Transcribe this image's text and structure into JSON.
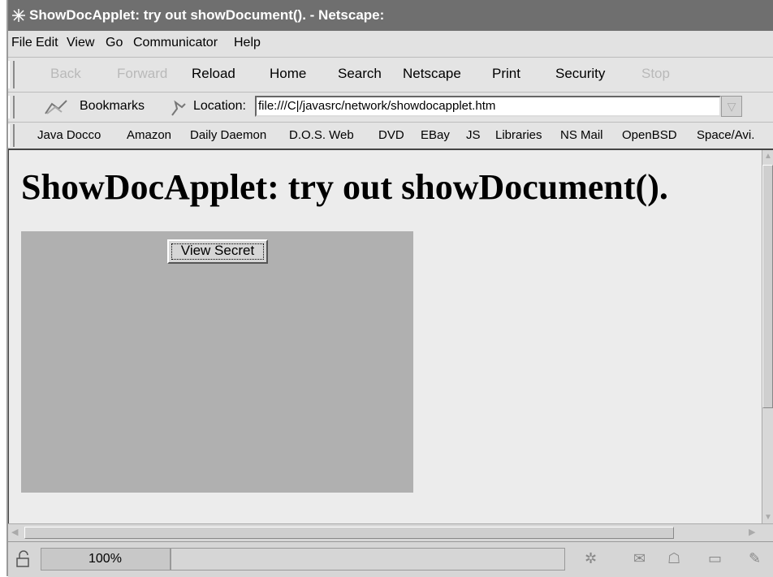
{
  "window": {
    "title": "ShowDocApplet: try out showDocument(). - Netscape:"
  },
  "menubar": {
    "items": [
      {
        "label": "File"
      },
      {
        "label": "Edit"
      },
      {
        "label": "View"
      },
      {
        "label": "Go"
      },
      {
        "label": "Communicator"
      },
      {
        "label": "Help"
      }
    ]
  },
  "navbar": {
    "back": "Back",
    "forward": "Forward",
    "reload": "Reload",
    "home": "Home",
    "search": "Search",
    "netscape": "Netscape",
    "print": "Print",
    "security": "Security",
    "stop": "Stop"
  },
  "locationbar": {
    "bookmarks_label": "Bookmarks",
    "location_label": "Location:",
    "url": "file:///C|/javasrc/network/showdocapplet.htm"
  },
  "personalbar": {
    "links": [
      {
        "label": "Java Docco"
      },
      {
        "label": "Amazon"
      },
      {
        "label": "Daily Daemon"
      },
      {
        "label": "D.O.S. Web"
      },
      {
        "label": "DVD"
      },
      {
        "label": "EBay"
      },
      {
        "label": "JS"
      },
      {
        "label": "Libraries"
      },
      {
        "label": "NS Mail"
      },
      {
        "label": "OpenBSD"
      },
      {
        "label": "Space/Avi."
      }
    ]
  },
  "page": {
    "heading": "ShowDocApplet: try out showDocument().",
    "applet": {
      "button_label": "View Secret"
    }
  },
  "statusbar": {
    "zoom": "100%"
  },
  "colors": {
    "titlebar": "#6f6f6f",
    "chrome": "#e2e2e2",
    "content_bg": "#ececec",
    "applet_bg": "#b0b0b0"
  }
}
